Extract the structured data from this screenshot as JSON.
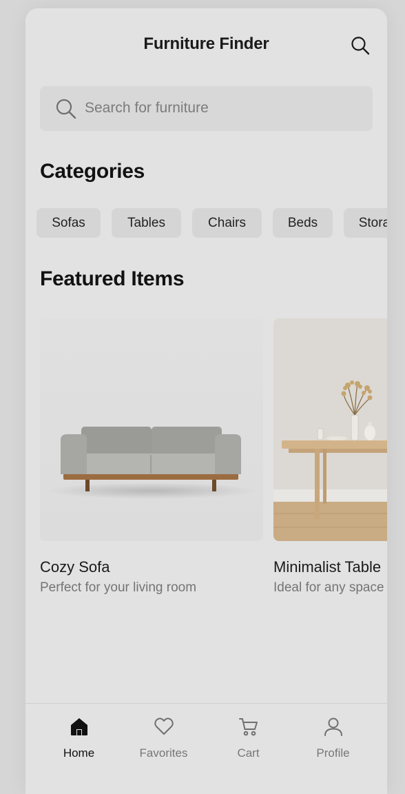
{
  "header": {
    "title": "Furniture Finder",
    "search_icon": "search-icon"
  },
  "search": {
    "placeholder": "Search for furniture",
    "icon": "search-icon"
  },
  "categories": {
    "title": "Categories",
    "items": [
      "Sofas",
      "Tables",
      "Chairs",
      "Beds",
      "Storage"
    ]
  },
  "featured": {
    "title": "Featured Items",
    "items": [
      {
        "name": "Cozy Sofa",
        "description": "Perfect for your living room"
      },
      {
        "name": "Minimalist Table",
        "description": "Ideal for any space"
      }
    ]
  },
  "bottom_nav": {
    "items": [
      {
        "label": "Home",
        "icon": "home-icon",
        "active": true
      },
      {
        "label": "Favorites",
        "icon": "heart-icon",
        "active": false
      },
      {
        "label": "Cart",
        "icon": "cart-icon",
        "active": false
      },
      {
        "label": "Profile",
        "icon": "user-icon",
        "active": false
      }
    ]
  },
  "colors": {
    "background": "#e2e2e2",
    "surface": "#d8d8d8",
    "text_primary": "#1a1a1a",
    "text_secondary": "#747474"
  }
}
